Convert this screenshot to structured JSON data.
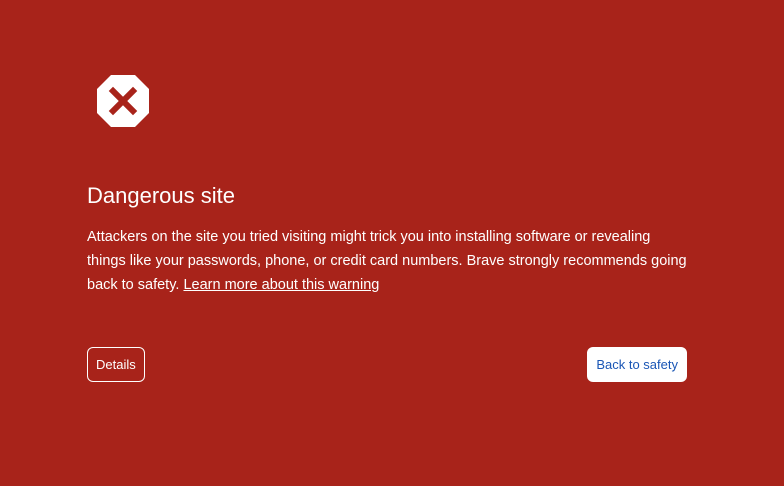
{
  "warning": {
    "icon": "stop-x-icon",
    "title": "Dangerous site",
    "message": "Attackers on the site you tried visiting might trick you into installing software or revealing things like your passwords, phone, or credit card numbers. Brave strongly recommends going back to safety.",
    "learn_more_link": "Learn more about this warning"
  },
  "buttons": {
    "details_label": "Details",
    "back_to_safety_label": "Back to safety"
  },
  "colors": {
    "background": "#a8231a",
    "text": "#ffffff",
    "safety_button_text": "#1a56b5"
  }
}
